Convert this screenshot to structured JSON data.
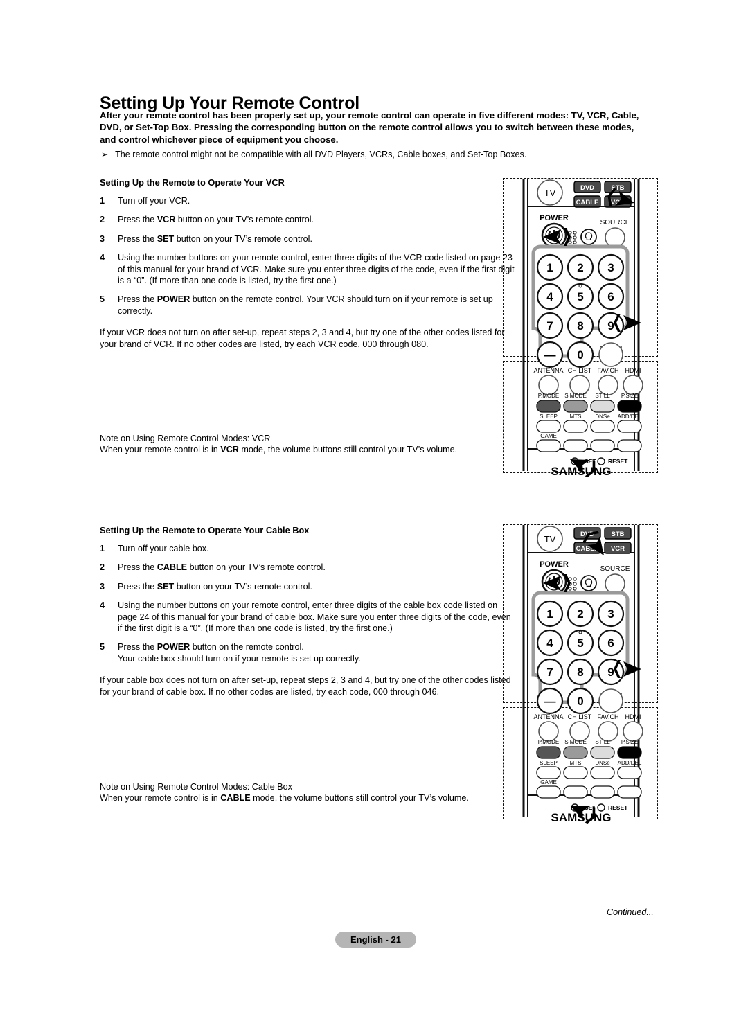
{
  "page": {
    "title": "Setting Up Your Remote Control",
    "intro": "After your remote control has been properly set up, your remote control can operate in five different modes: TV, VCR, Cable, DVD, or Set-Top Box. Pressing the corresponding button on the remote control allows you to switch between these modes, and control whichever piece of equipment you choose.",
    "bullet_glyph": "➢",
    "bullet_text": "The remote control might not be compatible with all DVD Players, VCRs, Cable boxes, and Set-Top Boxes.",
    "continued": "Continued...",
    "page_label": "English - 21",
    "page_pill_color": "#b5b5b5"
  },
  "vcr_section": {
    "heading": "Setting Up the Remote to Operate Your VCR",
    "steps": [
      {
        "num": "1",
        "text": "Turn off your VCR."
      },
      {
        "num": "2",
        "text": "Press the VCR button on your TV’s remote control.",
        "bold": "VCR"
      },
      {
        "num": "3",
        "text": "Press the SET button on your TV’s remote control.",
        "bold": "SET"
      },
      {
        "num": "4",
        "text": "Using the number buttons on your remote control, enter three digits of the VCR code listed on page 23 of this manual for your brand of VCR. Make sure you enter three digits of the code, even if the first digit is a “0”. (If more than one code is listed, try the first one.)"
      },
      {
        "num": "5",
        "text": "Press the POWER button on the remote control. Your VCR should turn on if your remote is set up correctly.",
        "bold": "POWER"
      }
    ],
    "closing": "If your VCR does not turn on after set-up, repeat steps 2, 3 and 4, but try one of the other codes listed for your brand of VCR. If no other codes are listed, try each VCR code, 000 through 080.",
    "note_line1": "Note on Using Remote Control Modes: VCR",
    "note_line2": "When your remote control is in VCR mode, the volume buttons still control your TV’s volume.",
    "note_bold": "VCR"
  },
  "cable_section": {
    "heading": "Setting Up the Remote to Operate Your Cable Box",
    "steps": [
      {
        "num": "1",
        "text": "Turn off your cable box."
      },
      {
        "num": "2",
        "text": "Press the CABLE button on your TV’s remote control.",
        "bold": "CABLE"
      },
      {
        "num": "3",
        "text": "Press the SET button on your TV’s remote control.",
        "bold": "SET"
      },
      {
        "num": "4",
        "text": "Using the number buttons on your remote control, enter three digits of the cable box code listed on page 24 of this manual for your brand of cable box. Make sure you enter three digits of the code, even if the first digit is a “0”. (If more than one code is listed, try the first one.)"
      },
      {
        "num": "5",
        "text": "Press the POWER button on the remote control.\nYour cable box should turn on if your remote is set up correctly.",
        "bold": "POWER"
      }
    ],
    "closing": "If your cable box does not turn on after set-up, repeat steps 2, 3 and 4, but try one of the other codes listed for your brand of cable box. If no other codes are listed, try each code, 000 through 046.",
    "note_line1": "Note on Using Remote Control Modes: Cable Box",
    "note_line2": "When your remote control is in CABLE mode, the volume buttons still control your TV’s volume.",
    "note_bold": "CABLE"
  },
  "remote": {
    "mode_buttons": [
      "TV",
      "DVD",
      "STB",
      "CABLE",
      "VCR"
    ],
    "power_label": "POWER",
    "source_label": "SOURCE",
    "keypad": [
      "1",
      "2",
      "3",
      "4",
      "5",
      "6",
      "7",
      "8",
      "9",
      "—",
      "0",
      "PRE-CH"
    ],
    "bottom_row_labels": [
      "ANTENNA",
      "CH LIST",
      "FAV.CH",
      "HDMI"
    ],
    "function_row1": [
      "P.MODE",
      "S.MODE",
      "STILL",
      "P.SIZE"
    ],
    "function_row2": [
      "SLEEP",
      "MTS",
      "DNSe",
      "ADD/DEL"
    ],
    "function_row3": [
      "GAME"
    ],
    "set_label": "SET",
    "reset_label": "RESET",
    "brand": "SAMSUNG",
    "button_colors": {
      "p_mode": "#555555",
      "s_mode": "#9a9a9a",
      "still": "#dcdcdc",
      "p_size": "#000000",
      "mode_key_bg": "#4a4a4a"
    }
  },
  "illustrations": {
    "top_vcr_highlight": "VCR",
    "bottom_cable_highlight": "CABLE"
  }
}
